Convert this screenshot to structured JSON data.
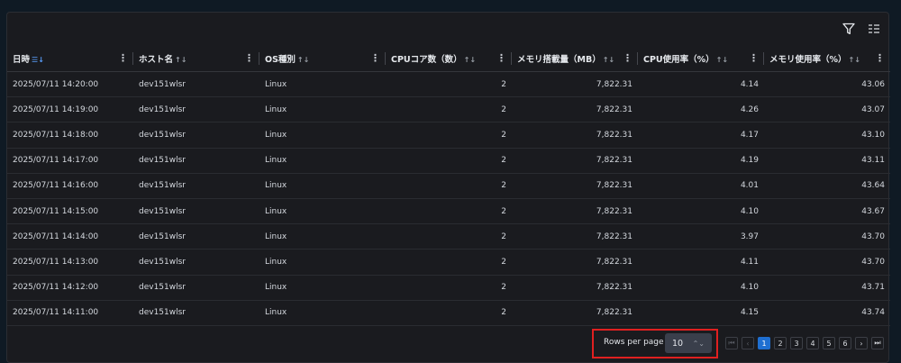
{
  "toolbar": {
    "filter_icon": "filter-icon",
    "columns_icon": "columns-icon"
  },
  "columns": [
    {
      "label": "日時",
      "sort": "☰↓",
      "active": true
    },
    {
      "label": "ホスト名",
      "sort": "↑↓",
      "active": false
    },
    {
      "label": "OS種別",
      "sort": "↑↓",
      "active": false
    },
    {
      "label": "CPUコア数（数）",
      "sort": "↑↓",
      "active": false
    },
    {
      "label": "メモリ搭載量（MB）",
      "sort": "↑↓",
      "active": false
    },
    {
      "label": "CPU使用率（%）",
      "sort": "↑↓",
      "active": false
    },
    {
      "label": "メモリ使用率（%）",
      "sort": "↑↓",
      "active": false
    }
  ],
  "rows": [
    [
      "2025/07/11 14:20:00",
      "dev151wlsr",
      "Linux",
      "2",
      "7,822.31",
      "4.14",
      "43.06"
    ],
    [
      "2025/07/11 14:19:00",
      "dev151wlsr",
      "Linux",
      "2",
      "7,822.31",
      "4.26",
      "43.07"
    ],
    [
      "2025/07/11 14:18:00",
      "dev151wlsr",
      "Linux",
      "2",
      "7,822.31",
      "4.17",
      "43.10"
    ],
    [
      "2025/07/11 14:17:00",
      "dev151wlsr",
      "Linux",
      "2",
      "7,822.31",
      "4.19",
      "43.11"
    ],
    [
      "2025/07/11 14:16:00",
      "dev151wlsr",
      "Linux",
      "2",
      "7,822.31",
      "4.01",
      "43.64"
    ],
    [
      "2025/07/11 14:15:00",
      "dev151wlsr",
      "Linux",
      "2",
      "7,822.31",
      "4.10",
      "43.67"
    ],
    [
      "2025/07/11 14:14:00",
      "dev151wlsr",
      "Linux",
      "2",
      "7,822.31",
      "3.97",
      "43.70"
    ],
    [
      "2025/07/11 14:13:00",
      "dev151wlsr",
      "Linux",
      "2",
      "7,822.31",
      "4.11",
      "43.70"
    ],
    [
      "2025/07/11 14:12:00",
      "dev151wlsr",
      "Linux",
      "2",
      "7,822.31",
      "4.10",
      "43.71"
    ],
    [
      "2025/07/11 14:11:00",
      "dev151wlsr",
      "Linux",
      "2",
      "7,822.31",
      "4.15",
      "43.74"
    ]
  ],
  "footer": {
    "rows_per_page_label": "Rows per page",
    "rows_per_page_value": "10",
    "first": "⏮",
    "prev": "‹",
    "next": "›",
    "last": "⏭",
    "pages": [
      "1",
      "2",
      "3",
      "4",
      "5",
      "6"
    ],
    "current_page": "1"
  },
  "colors": {
    "accent": "#1f6fd1",
    "highlight": "#e02020",
    "background": "#1a1b1f"
  }
}
